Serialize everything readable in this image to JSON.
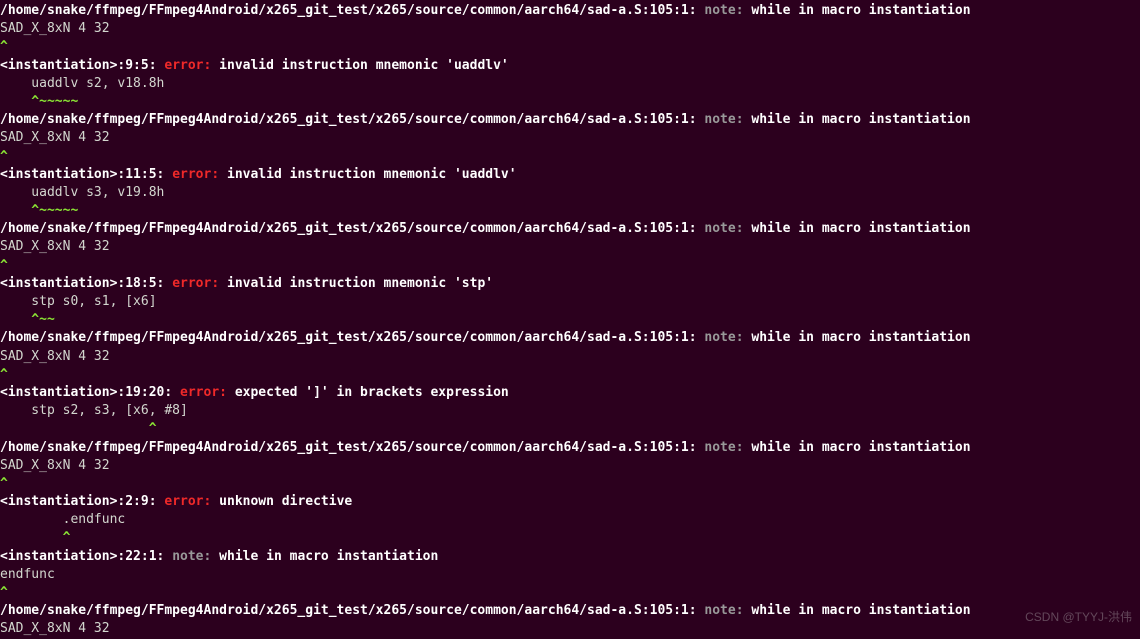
{
  "file_path": "/home/snake/ffmpeg/FFmpeg4Android/x265_git_test/x265/source/common/aarch64/sad-a.S:105:1:",
  "note_label": "note:",
  "error_label": "error:",
  "note_msg": "while in macro instantiation",
  "macro_line": "SAD_X_8xN 4 32",
  "caret1": "^",
  "caret_tilde": "^~~~~~",
  "caret_short": "^~~",
  "caret_mid": "^",
  "blocks": {
    "b1": {
      "loc": "<instantiation>:9:5:",
      "err": "invalid instruction mnemonic 'uaddlv'",
      "code": "    uaddlv s2, v18.8h",
      "caret": "    ^~~~~~"
    },
    "b2": {
      "loc": "<instantiation>:11:5:",
      "err": "invalid instruction mnemonic 'uaddlv'",
      "code": "    uaddlv s3, v19.8h",
      "caret": "    ^~~~~~"
    },
    "b3": {
      "loc": "<instantiation>:18:5:",
      "err": "invalid instruction mnemonic 'stp'",
      "code": "    stp s0, s1, [x6]",
      "caret": "    ^~~"
    },
    "b4": {
      "loc": "<instantiation>:19:20:",
      "err": "expected ']' in brackets expression",
      "code": "    stp s2, s3, [x6, #8]",
      "caret": "                   ^"
    },
    "b5": {
      "loc": "<instantiation>:2:9:",
      "err": "unknown directive",
      "code": "        .endfunc",
      "caret": "        ^"
    },
    "b6": {
      "loc": "<instantiation>:22:1:",
      "note": "while in macro instantiation",
      "code": "endfunc",
      "caret": "^"
    }
  },
  "watermark": "CSDN @TYYJ-洪伟"
}
